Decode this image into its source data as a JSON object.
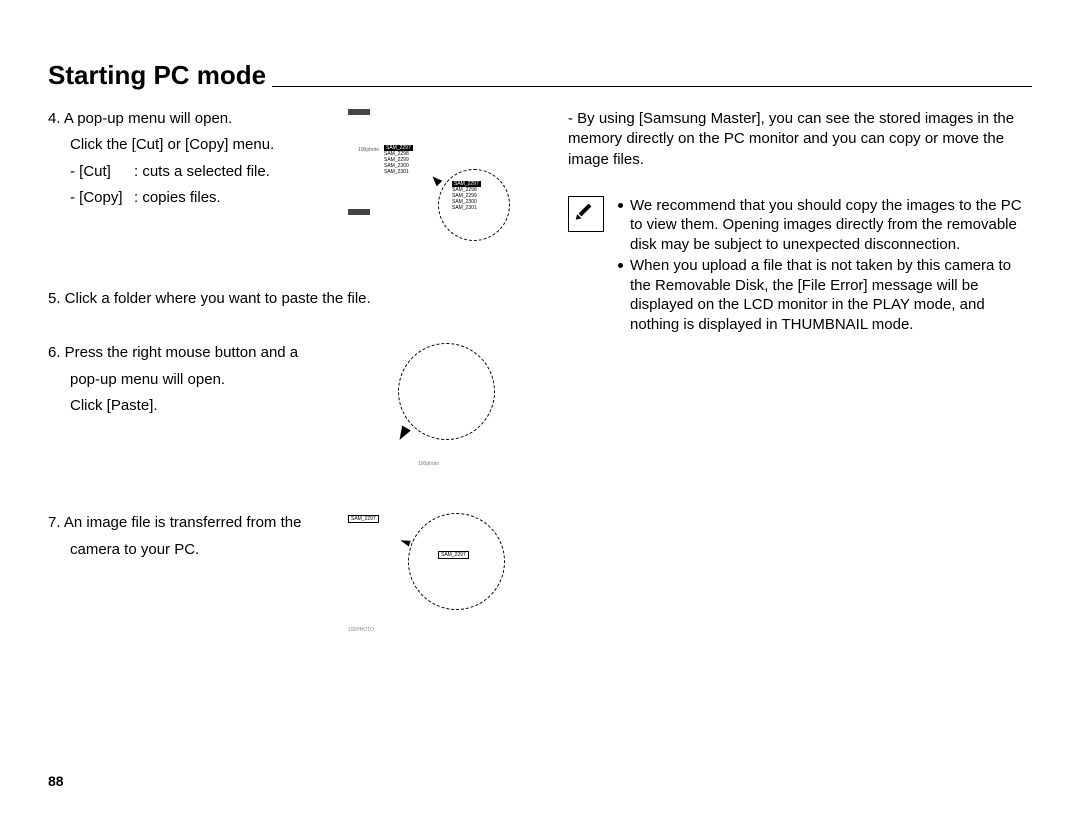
{
  "title": "Starting PC mode",
  "page_number": "88",
  "left": {
    "step4": {
      "line1": "4. A pop-up menu will open.",
      "line2": "Click the [Cut] or [Copy] menu.",
      "cut_label": "- [Cut]",
      "cut_desc": ": cuts a selected file.",
      "copy_label": "- [Copy]",
      "copy_desc": ": copies files."
    },
    "step5": "5. Click a folder where you want to paste the file.",
    "step6": {
      "line1": "6. Press the right mouse button and a",
      "line2": "pop-up menu will open.",
      "line3": "Click [Paste]."
    },
    "step7": {
      "line1": "7. An image file is transferred from the",
      "line2": "camera to your PC."
    }
  },
  "fig4": {
    "mid_label": "100photo",
    "sel_item": "SAM_2297",
    "items": [
      "SAM_2298",
      "SAM_2299",
      "SAM_2300",
      "SAM_2301"
    ],
    "callout_sel": "SAM_2297",
    "callout_items": [
      "SAM_2298",
      "SAM_2299",
      "SAM_2300",
      "SAM_2301"
    ]
  },
  "fig6": {
    "tiny": "100photo"
  },
  "fig7": {
    "label": "SAM_2297",
    "inner": "SAM_2297",
    "tiny": "100PHOTO"
  },
  "right": {
    "para": "- By using [Samsung Master], you can see the stored images in the memory directly on the PC monitor and you can copy or move the image files.",
    "note1": "We recommend that you should copy the images to the PC to view them. Opening images directly from the removable disk may be subject to unexpected disconnection.",
    "note2": "When you upload a file that is not taken by this camera to the Removable Disk, the [File Error] message will be displayed on the LCD monitor in the PLAY mode, and nothing is displayed in THUMBNAIL mode."
  }
}
